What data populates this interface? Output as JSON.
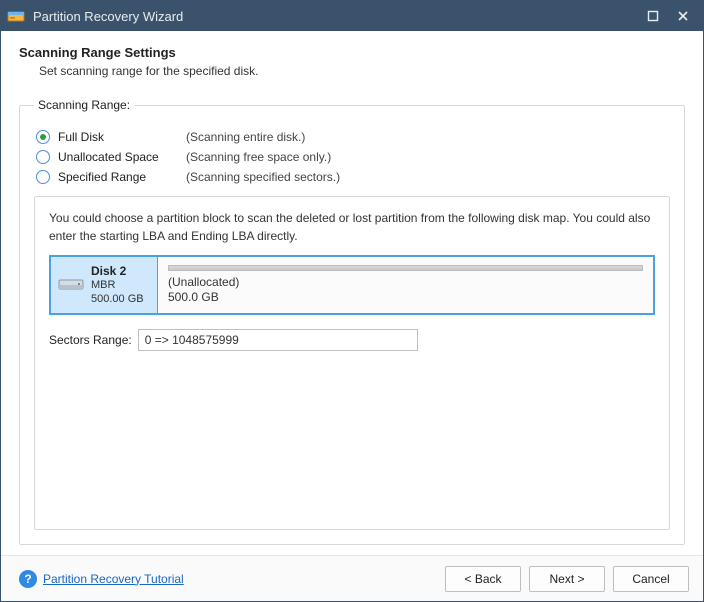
{
  "titlebar": {
    "title": "Partition Recovery Wizard"
  },
  "header": {
    "title": "Scanning Range Settings",
    "subtitle": "Set scanning range for the specified disk."
  },
  "fieldset": {
    "legend": "Scanning Range:",
    "options": [
      {
        "label": "Full Disk",
        "desc": "(Scanning entire disk.)",
        "selected": true
      },
      {
        "label": "Unallocated Space",
        "desc": "(Scanning free space only.)",
        "selected": false
      },
      {
        "label": "Specified Range",
        "desc": "(Scanning specified sectors.)",
        "selected": false
      }
    ],
    "helptext": "You could choose a partition block to scan the deleted or lost partition from the following disk map. You could also enter the starting LBA and Ending LBA directly.",
    "disk": {
      "name": "Disk 2",
      "scheme": "MBR",
      "size": "500.00 GB",
      "partition": {
        "label": "(Unallocated)",
        "size": "500.0 GB"
      }
    },
    "sectors": {
      "label": "Sectors Range:",
      "value": "0 => 1048575999"
    }
  },
  "footer": {
    "help_link": "Partition Recovery Tutorial",
    "back": "< Back",
    "next": "Next >",
    "cancel": "Cancel"
  }
}
